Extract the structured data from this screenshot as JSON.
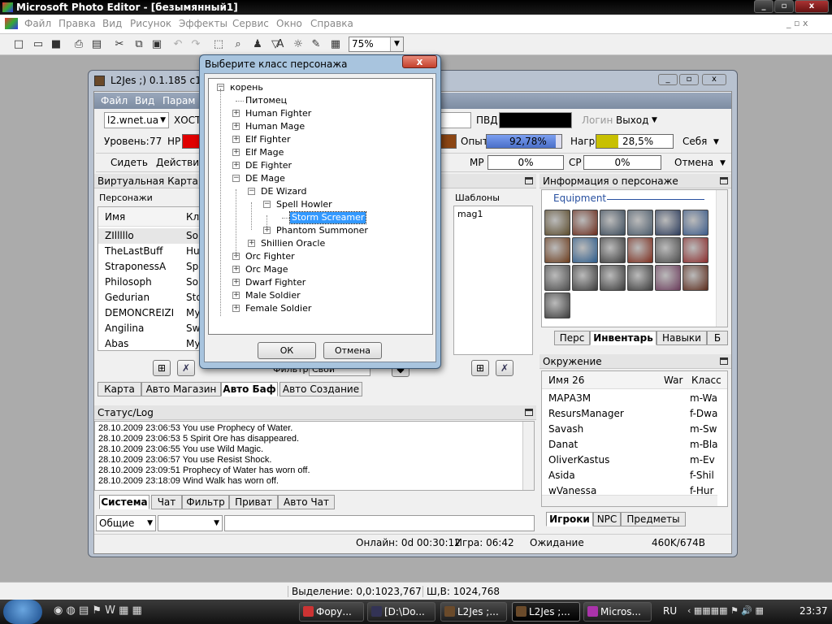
{
  "outer": {
    "title": "Microsoft Photo Editor - [безымянный1]",
    "menu": [
      "Файл",
      "Правка",
      "Вид",
      "Рисунок",
      "Эффекты",
      "Сервис",
      "Окно",
      "Справка"
    ],
    "zoom": "75%",
    "status_selection": "Выделение: 0,0:1023,767",
    "status_size": "Ш,В: 1024,768"
  },
  "l2": {
    "title": "L2Jes ;) 0.1.185 c1z1",
    "menu": [
      "Файл",
      "Вид",
      "Парам"
    ],
    "server": "l2.wnet.ua",
    "host_label": "ХОСТ",
    "pvd_label": "ПВД:",
    "login_label": "Логин",
    "exit_label": "Выход",
    "level_label": "Уровень:",
    "level_value": "77",
    "hp_label": "HP",
    "exp_label": "Опыт",
    "exp_value": "92,78%",
    "exp_fill": 0.9278,
    "reward_label": "Нагр.",
    "reward_value": "28,5%",
    "reward_fill": 0.285,
    "self_label": "Себя",
    "sit_label": "Сидеть",
    "action_label": "Действие",
    "mp_label": "MP",
    "mp_value": "0%",
    "cp_label": "CP",
    "cp_value": "0%",
    "cancel_label": "Отмена",
    "virtual_map": "Виртуальная Карта",
    "chars_label": "Персонажи",
    "col_name": "Имя",
    "col_class": "Кл",
    "characters": [
      {
        "name": "ZIlllllo",
        "cls": "Sou"
      },
      {
        "name": "TheLastBuff",
        "cls": "Hu"
      },
      {
        "name": "StraponessA",
        "cls": "Spe"
      },
      {
        "name": "Philosoph",
        "cls": "Sou"
      },
      {
        "name": "Gedurian",
        "cls": "Sto"
      },
      {
        "name": "DEMONCREIZI",
        "cls": "My"
      },
      {
        "name": "Angilina",
        "cls": "Sw"
      },
      {
        "name": "Abas",
        "cls": "My"
      }
    ],
    "templates_label": "Шаблоны",
    "template_item": "mag1",
    "filter_label": "Фильтр",
    "filter_value": "Свои",
    "bottom_tabs": [
      "Карта",
      "Авто Магазин",
      "Авто Баф",
      "Авто Создание"
    ],
    "status_label": "Статус/Log",
    "log": [
      "28.10.2009 23:06:53 You use Prophecy of Water.",
      "28.10.2009 23:06:53 5 Spirit Ore has disappeared.",
      "28.10.2009 23:06:55 You use Wild Magic.",
      "28.10.2009 23:06:57 You use Resist Shock.",
      "28.10.2009 23:09:51 Prophecy of Water has worn off.",
      "28.10.2009 23:18:09 Wind Walk has worn off."
    ],
    "chat_tabs": [
      "Система",
      "Чат",
      "Фильтр",
      "Приват",
      "Авто Чат"
    ],
    "chat_channel": "Общие",
    "online": "Онлайн: 0d 00:30:12",
    "game": "Игра: 06:42",
    "waiting": "Ожидание",
    "memory": "460K/674B",
    "info_label": "Информация о персонаже",
    "equipment_label": "Equipment",
    "info_tabs": [
      "Перс",
      "Инвентарь",
      "Навыки",
      "Б"
    ],
    "env_label": "Окружение",
    "env_cols": [
      "Имя 26",
      "War",
      "Класс"
    ],
    "env_rows": [
      {
        "name": "МАРАЗМ",
        "cls": "m-Wa"
      },
      {
        "name": "ResursManager",
        "cls": "f-Dwa"
      },
      {
        "name": "Savash",
        "cls": "m-Sw"
      },
      {
        "name": "Danat",
        "cls": "m-Bla"
      },
      {
        "name": "OliverKastus",
        "cls": "m-Ev"
      },
      {
        "name": "Asida",
        "cls": "f-Shil"
      },
      {
        "name": "wVanessa",
        "cls": "f-Hur"
      }
    ],
    "env_tabs": [
      "Игроки",
      "NPC",
      "Предметы"
    ]
  },
  "dialog": {
    "title": "Выберите класс персонажа",
    "close": "x",
    "ok": "ОК",
    "cancel": "Отмена",
    "tree": [
      {
        "label": "корень",
        "level": 0,
        "pm": "minus"
      },
      {
        "label": "Питомец",
        "level": 1,
        "pm": ""
      },
      {
        "label": "Human Fighter",
        "level": 1,
        "pm": "plus"
      },
      {
        "label": "Human Mage",
        "level": 1,
        "pm": "plus"
      },
      {
        "label": "Elf Fighter",
        "level": 1,
        "pm": "plus"
      },
      {
        "label": "Elf Mage",
        "level": 1,
        "pm": "plus"
      },
      {
        "label": "DE Fighter",
        "level": 1,
        "pm": "plus"
      },
      {
        "label": "DE Mage",
        "level": 1,
        "pm": "minus"
      },
      {
        "label": "DE Wizard",
        "level": 2,
        "pm": "minus"
      },
      {
        "label": "Spell Howler",
        "level": 3,
        "pm": "minus"
      },
      {
        "label": "Storm Screamer",
        "level": 4,
        "pm": "",
        "selected": true
      },
      {
        "label": "Phantom Summoner",
        "level": 3,
        "pm": "plus"
      },
      {
        "label": "Shillien Oracle",
        "level": 2,
        "pm": "plus"
      },
      {
        "label": "Orc Fighter",
        "level": 1,
        "pm": "plus"
      },
      {
        "label": "Orc Mage",
        "level": 1,
        "pm": "plus"
      },
      {
        "label": "Dwarf Fighter",
        "level": 1,
        "pm": "plus"
      },
      {
        "label": "Male Soldier",
        "level": 1,
        "pm": "plus"
      },
      {
        "label": "Female Soldier",
        "level": 1,
        "pm": "plus"
      }
    ]
  },
  "taskbar": {
    "items": [
      "Фору...",
      "[D:\\Do...",
      "L2Jes ;...",
      "L2Jes ;...",
      "Micros..."
    ],
    "lang": "RU",
    "clock": "23:37"
  },
  "colors": {
    "hp": "#e00000",
    "exp": "#5a7fd8",
    "reward": "#c8c000",
    "selection": "#3399ff"
  }
}
